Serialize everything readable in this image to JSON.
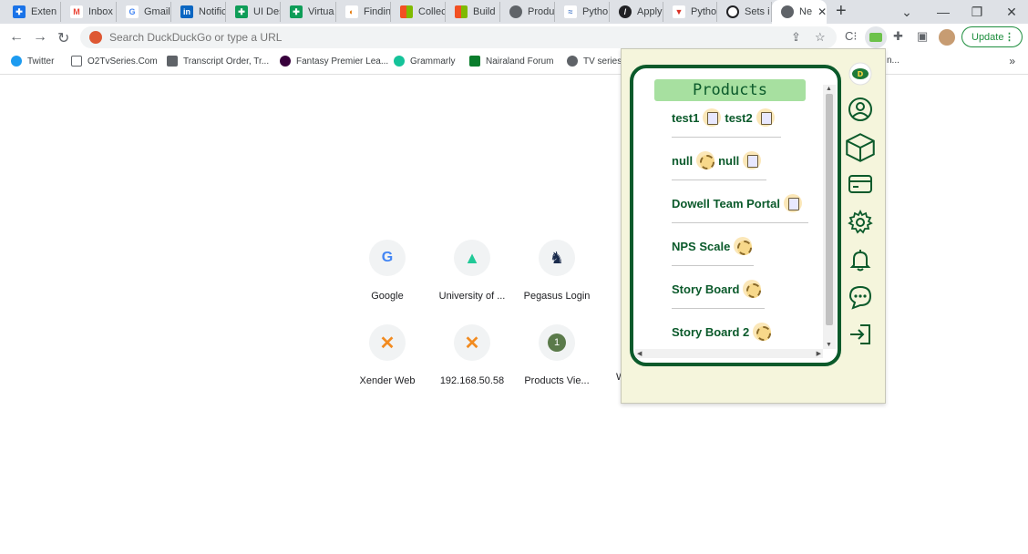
{
  "tabs": [
    {
      "label": "Exten",
      "icon": "puzzle-icon",
      "color": "#1a73e8"
    },
    {
      "label": "Inbox",
      "icon": "gmail-icon",
      "color": "#ea4335"
    },
    {
      "label": "Gmail",
      "icon": "google-icon",
      "color": "#4285f4"
    },
    {
      "label": "Notific",
      "icon": "linkedin-icon",
      "color": "#0a66c2"
    },
    {
      "label": "UI Des",
      "icon": "sheets-icon",
      "color": "#0f9d58"
    },
    {
      "label": "Virtua",
      "icon": "sheets-icon",
      "color": "#0f9d58"
    },
    {
      "label": "Findin",
      "icon": "findin-icon",
      "color": "#e37400"
    },
    {
      "label": "Collec",
      "icon": "microsoft-icon",
      "color": "#f25022"
    },
    {
      "label": "Build",
      "icon": "microsoft-icon",
      "color": "#f25022"
    },
    {
      "label": "Produ",
      "icon": "globe-icon",
      "color": "#5f6368"
    },
    {
      "label": "Pytho",
      "icon": "wave-icon",
      "color": "#4a7cc9"
    },
    {
      "label": "Apply",
      "icon": "circle-icon",
      "color": "#202124"
    },
    {
      "label": "Pytho",
      "icon": "v-icon",
      "color": "#d93025"
    },
    {
      "label": "Sets i",
      "icon": "ring-icon",
      "color": "#202124"
    },
    {
      "label": "Ne",
      "icon": "globe-icon",
      "color": "#5f6368",
      "active": true
    }
  ],
  "omnibox": {
    "placeholder": "Search DuckDuckGo or type a URL"
  },
  "update_label": "Update",
  "bookmarks": [
    {
      "label": "Twitter",
      "color": "#1d9bf0"
    },
    {
      "label": "O2TvSeries.Com",
      "color": "#5f6368"
    },
    {
      "label": "Transcript Order, Tr...",
      "color": "#5f6368"
    },
    {
      "label": "Fantasy Premier Lea...",
      "color": "#38003c"
    },
    {
      "label": "Grammarly",
      "color": "#15c39a"
    },
    {
      "label": "Nairaland Forum",
      "color": "#0a7d2c"
    },
    {
      "label": "TV series",
      "color": "#5f6368"
    }
  ],
  "bookmark_tail": "n...",
  "shortcuts": [
    {
      "label": "Google",
      "glyph": "G",
      "color": "#4285f4"
    },
    {
      "label": "University of ...",
      "glyph": "▲",
      "color": "#20c997"
    },
    {
      "label": "Pegasus Login",
      "glyph": "♞",
      "color": "#1a2b4c"
    },
    {
      "label": "Xender Web",
      "glyph": "✕",
      "color": "#f28b20"
    },
    {
      "label": "192.168.50.58",
      "glyph": "✕",
      "color": "#f28b20"
    },
    {
      "label": "Products Vie...",
      "glyph": "1",
      "color": "#5a7a4a"
    }
  ],
  "shortcut_hidden_initial": "W",
  "popup": {
    "header": "Products",
    "rows": [
      {
        "items": [
          "test1",
          "test2"
        ]
      },
      {
        "items": [
          "null",
          "null"
        ]
      },
      {
        "items": [
          "Dowell Team Portal"
        ]
      },
      {
        "items": [
          "NPS Scale"
        ]
      },
      {
        "items": [
          "Story Board"
        ]
      },
      {
        "items": [
          "Story Board 2"
        ]
      }
    ],
    "accent_color": "#0b5a2b",
    "header_bg": "#a7e0a0",
    "panel_bg": "#f5f5dc"
  }
}
